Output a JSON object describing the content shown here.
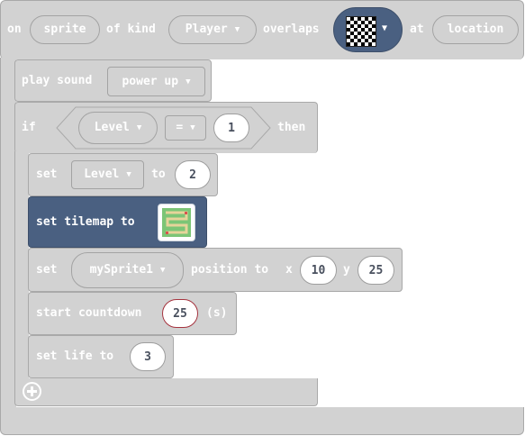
{
  "event": {
    "on": "on",
    "sprite": "sprite",
    "of_kind": "of kind",
    "kind_value": "Player",
    "overlaps": "overlaps",
    "at": "at",
    "location": "location"
  },
  "blocks": {
    "play_sound": {
      "label": "play sound",
      "sound": "power up"
    },
    "if_block": {
      "if": "if",
      "variable": "Level",
      "operator": "=",
      "value": "1",
      "then": "then"
    },
    "set_level": {
      "set": "set",
      "variable": "Level",
      "to": "to",
      "value": "2"
    },
    "set_tilemap": {
      "label": "set tilemap to"
    },
    "set_position": {
      "set": "set",
      "sprite": "mySprite1",
      "position_to": "position to",
      "x_label": "x",
      "x_value": "10",
      "y_label": "y",
      "y_value": "25"
    },
    "countdown": {
      "label": "start countdown",
      "value": "25",
      "unit": "(s)"
    },
    "set_life": {
      "label": "set life to",
      "value": "3"
    }
  },
  "colors": {
    "block_grey": "#d2d2d2",
    "block_dark": "#4a6081",
    "text_white": "#ffffff",
    "number_text": "#49505e"
  },
  "icons": {
    "dropdown": "chevron-down-icon",
    "add": "plus-circle-icon",
    "tile": "checkerboard-tile-icon",
    "tilemap": "tilemap-thumbnail-icon"
  }
}
